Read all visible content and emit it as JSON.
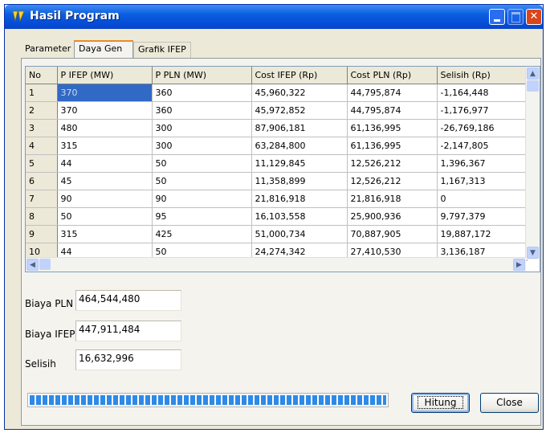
{
  "window": {
    "title": "Hasil Program"
  },
  "tabs": [
    "Parameter",
    "Daya Gen",
    "Grafik IFEP"
  ],
  "active_tab": "Daya Gen",
  "table": {
    "columns": [
      "No",
      "P IFEP (MW)",
      "P PLN (MW)",
      "Cost IFEP (Rp)",
      "Cost PLN (Rp)",
      "Selisih (Rp)"
    ],
    "rows": [
      [
        "1",
        "370",
        "360",
        "45,960,322",
        "44,795,874",
        "-1,164,448"
      ],
      [
        "2",
        "370",
        "360",
        "45,972,852",
        "44,795,874",
        "-1,176,977"
      ],
      [
        "3",
        "480",
        "300",
        "87,906,181",
        "61,136,995",
        "-26,769,186"
      ],
      [
        "4",
        "315",
        "300",
        "63,284,800",
        "61,136,995",
        "-2,147,805"
      ],
      [
        "5",
        "44",
        "50",
        "11,129,845",
        "12,526,212",
        "1,396,367"
      ],
      [
        "6",
        "45",
        "50",
        "11,358,899",
        "12,526,212",
        "1,167,313"
      ],
      [
        "7",
        "90",
        "90",
        "21,816,918",
        "21,816,918",
        "0"
      ],
      [
        "8",
        "50",
        "95",
        "16,103,558",
        "25,900,936",
        "9,797,379"
      ],
      [
        "9",
        "315",
        "425",
        "51,000,734",
        "70,887,905",
        "19,887,172"
      ],
      [
        "10",
        "44",
        "50",
        "24,274,342",
        "27,410,530",
        "3,136,187"
      ]
    ]
  },
  "summary": {
    "biaya_pln_label": "Biaya PLN",
    "biaya_pln_value": "464,544,480",
    "biaya_ifep_label": "Biaya IFEP",
    "biaya_ifep_value": "447,911,484",
    "selisih_label": "Selisih",
    "selisih_value": "16,632,996"
  },
  "progress": {
    "value": 1.0
  },
  "buttons": {
    "hitung": "Hitung",
    "close": "Close"
  },
  "colors": {
    "titlebar": "#0a5ee0",
    "selection": "#316ac5",
    "progress": "#2e8ae6"
  }
}
